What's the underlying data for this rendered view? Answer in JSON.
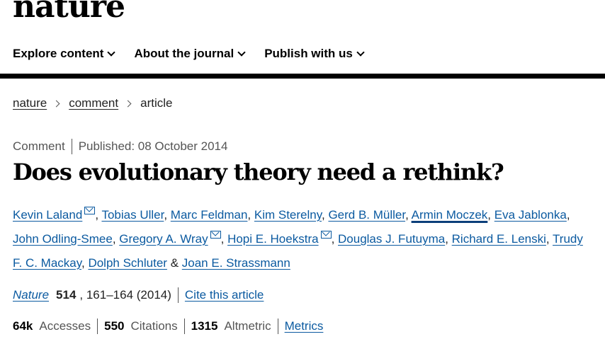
{
  "header": {
    "logo": "nature"
  },
  "nav": [
    {
      "label": "Explore content"
    },
    {
      "label": "About the journal"
    },
    {
      "label": "Publish with us"
    }
  ],
  "breadcrumb": [
    "nature",
    "comment",
    "article"
  ],
  "article": {
    "type": "Comment",
    "published": "Published: 08 October 2014",
    "title": "Does evolutionary theory need a rethink?"
  },
  "authors": [
    {
      "name": "Kevin Laland",
      "mail": true
    },
    {
      "name": "Tobias Uller"
    },
    {
      "name": "Marc Feldman"
    },
    {
      "name": "Kim Sterelny"
    },
    {
      "name": "Gerd B. Müller"
    },
    {
      "name": "Armin Moczek",
      "highlighted": true
    },
    {
      "name": "Eva Jablonka"
    },
    {
      "name": "John Odling-Smee"
    },
    {
      "name": "Gregory A. Wray",
      "mail": true
    },
    {
      "name": "Hopi E. Hoekstra",
      "mail": true
    },
    {
      "name": "Douglas J. Futuyma"
    },
    {
      "name": "Richard E. Lenski"
    },
    {
      "name": "Trudy F. C. Mackay"
    },
    {
      "name": "Dolph Schluter"
    },
    {
      "name": "Joan E. Strassmann"
    }
  ],
  "authors_ampersand": "&",
  "citation": {
    "journal": "Nature",
    "volume": "514",
    "pages": ", 161–164 (2014)",
    "cite_label": "Cite this article"
  },
  "metrics": {
    "accesses_value": "64k",
    "accesses_label": "Accesses",
    "citations_value": "550",
    "citations_label": "Citations",
    "altmetric_value": "1315",
    "altmetric_label": "Altmetric",
    "metrics_link": "Metrics"
  }
}
